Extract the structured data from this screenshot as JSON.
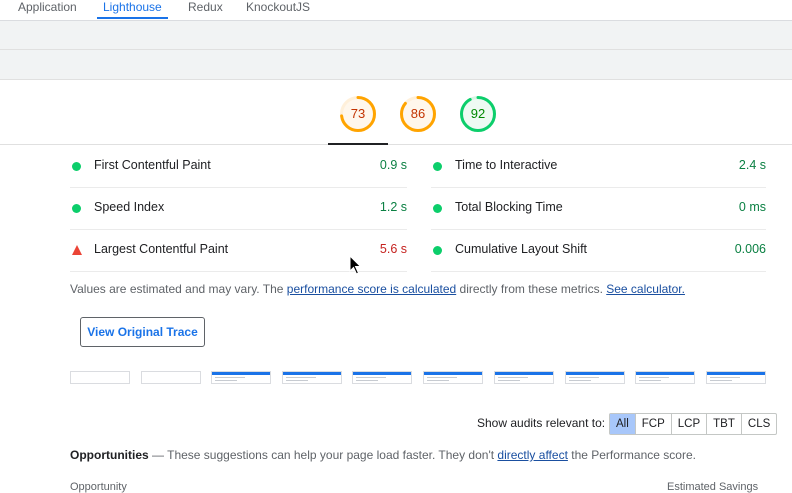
{
  "tabs": [
    {
      "label": "Application",
      "active": false
    },
    {
      "label": "Lighthouse",
      "active": true
    },
    {
      "label": "Redux",
      "active": false
    },
    {
      "label": "KnockoutJS",
      "active": false
    }
  ],
  "scores": [
    {
      "value": "73",
      "fraction": 0.73,
      "color": "#ffa400"
    },
    {
      "value": "86",
      "fraction": 0.86,
      "color": "#ffa400"
    },
    {
      "value": "92",
      "fraction": 0.92,
      "color": "#0cce6b"
    }
  ],
  "metrics": {
    "fcp": {
      "label": "First Contentful Paint",
      "value": "0.9 s",
      "status": "pass"
    },
    "si": {
      "label": "Speed Index",
      "value": "1.2 s",
      "status": "pass"
    },
    "lcp": {
      "label": "Largest Contentful Paint",
      "value": "5.6 s",
      "status": "fail"
    },
    "tti": {
      "label": "Time to Interactive",
      "value": "2.4 s",
      "status": "pass"
    },
    "tbt": {
      "label": "Total Blocking Time",
      "value": "0 ms",
      "status": "pass"
    },
    "cls": {
      "label": "Cumulative Layout Shift",
      "value": "0.006",
      "status": "pass"
    }
  },
  "note": {
    "prefix": "Values are estimated and may vary. The ",
    "link": "performance score is calculated",
    "middle": " directly from these metrics. ",
    "calc_link": "See calculator."
  },
  "trace_button": "View Original Trace",
  "filter": {
    "label": "Show audits relevant to:",
    "options": [
      "All",
      "FCP",
      "LCP",
      "TBT",
      "CLS"
    ],
    "selected": "All"
  },
  "opportunities": {
    "title": "Opportunities",
    "dash": " — ",
    "text": "These suggestions can help your page load faster. They don't ",
    "link": "directly affect",
    "suffix": " the Performance score."
  },
  "table_headers": {
    "left": "Opportunity",
    "right": "Estimated Savings"
  },
  "colors": {
    "accent": "#1a73e8",
    "pass": "#0cce6b",
    "average": "#ffa400",
    "fail": "#eb4436"
  }
}
